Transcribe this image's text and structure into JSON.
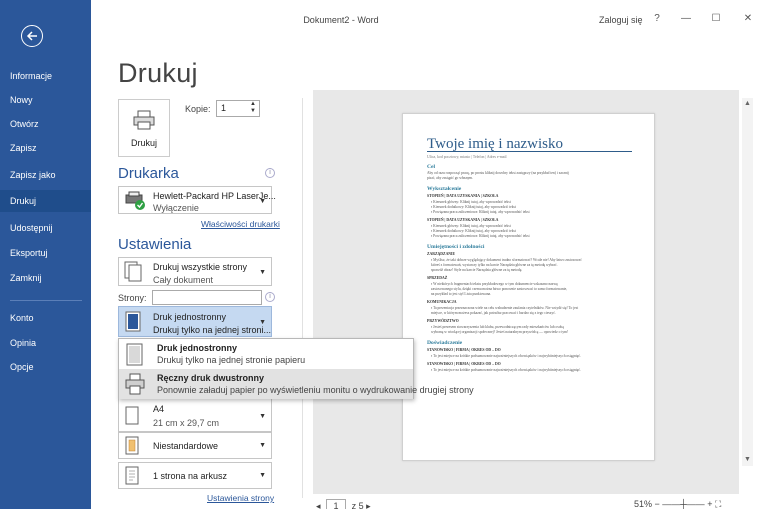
{
  "window": {
    "title": "Dokument2 - Word",
    "signin": "Zaloguj się",
    "help": "?",
    "minimize": "—",
    "maximize": "☐",
    "close": "✕"
  },
  "nav": {
    "items": [
      {
        "label": "Informacje"
      },
      {
        "label": "Nowy"
      },
      {
        "label": "Otwórz"
      },
      {
        "label": "Zapisz"
      },
      {
        "label": "Zapisz jako"
      },
      {
        "label": "Drukuj"
      },
      {
        "label": "Udostępnij"
      },
      {
        "label": "Eksportuj"
      },
      {
        "label": "Zamknij"
      },
      {
        "label": "Konto"
      },
      {
        "label": "Opinia"
      },
      {
        "label": "Opcje"
      }
    ],
    "active": "Drukuj"
  },
  "print": {
    "heading": "Drukuj",
    "button_label": "Drukuj",
    "copies_label": "Kopie:",
    "copies_value": "1"
  },
  "printer": {
    "heading": "Drukarka",
    "name": "Hewlett-Packard HP LaserJe...",
    "status": "Wyłączenie",
    "properties_link": "Właściwości drukarki"
  },
  "settings": {
    "heading": "Ustawienia",
    "range_title": "Drukuj wszystkie strony",
    "range_sub": "Cały dokument",
    "pages_label": "Strony:",
    "pages_value": "",
    "sides_title": "Druk jednostronny",
    "sides_sub": "Drukuj tylko na jednej stroni...",
    "paper_title": "A4",
    "paper_sub": "21 cm x 29,7 cm",
    "margins_title": "Niestandardowe",
    "persheet_title": "1 strona na arkusz",
    "page_setup_link": "Ustawienia strony"
  },
  "popup": {
    "options": [
      {
        "title": "Druk jednostronny",
        "sub": "Drukuj tylko na jednej stronie papieru"
      },
      {
        "title": "Ręczny druk dwustronny",
        "sub": "Ponownie załaduj papier po wyświetleniu monitu o wydrukowanie drugiej strony"
      }
    ]
  },
  "preview": {
    "name": "Twoje imię i nazwisko",
    "contact": "Ulica, kod pocztowy, miasto | Telefon | Adres e-mail",
    "s_goal": "Cel",
    "goal_1": "Aby od razu rozpocząć pracę, po prostu kliknij dowolny tekst zastępczy (na przykład ten) i zacznij",
    "goal_2": "pisać, aby zastąpić go własnym.",
    "s_edu": "Wykształcenie",
    "edu_sub": "STOPIEŃ | DATA UZYSKANIA | SZKOŁA",
    "edu_b1": "▪ Kierunek główny: Kliknij tutaj, aby wprowadzić tekst",
    "edu_b2": "▪ Kierunek dodatkowy: Kliknij tutaj, aby wprowadzić tekst",
    "edu_b3": "▪ Powiązana praca zaliczeniowa: Kliknij tutaj, aby wprowadzić tekst",
    "edu_sub2": "STOPIEŃ | DATA UZYSKANIA | SZKOŁA",
    "edu_b4": "▪ Kierunek główny: Kliknij tutaj, aby wprowadzić tekst",
    "edu_b5": "▪ Kierunek dodatkowy: Kliknij tutaj, aby wprowadzić tekst",
    "edu_b6": "▪ Powiązana praca zaliczeniowa: Kliknij tutaj, aby wprowadzić tekst",
    "s_skills": "Umiejętności i zdolności",
    "sk_sub1": "ZARZĄDZANIE",
    "sk_t1": "▪ Myślisz, że taki dobrze wyglądający dokument trudno sformatować? Wcale nie! Aby łatwo zastosować",
    "sk_t2": "   któreś z formatowań, wystarczy tylko na karcie Narzędzia główne za tę metodę wybrać.",
    "sk_t3": "   sprawdź obraz! Style na karcie Narzędzia główne za tę metodę.",
    "sk_sub2": "SPRZEDAŻ",
    "sk_t4": "▪ W niektórych fragmentach tekstu przykładowego w tym dokumencie wskazano nazwę",
    "sk_t5": "   zastosowanego stylu, dzięki czemu można łatwo ponownie zastosować to samo formatowanie,",
    "sk_t6": "   na przykład to jest styl Lista punktowana.",
    "sk_sub3": "KOMUNIKACJA",
    "sk_t7": "▪ Ta prezentacja przeznaczona wiele na celu wzbudzenie zaufania czytelników. Nie wstydź się! To jest",
    "sk_t8": "   miejsce, w którym możesz pokazać, jak potrafisz pracować i bardzo się z tego cieszyć.",
    "sk_sub4": "PRZYWÓDZTWO",
    "sk_t9": "▪ Jesteś prezesem stowarzyszenia lub klubu, przewodniczącym rady mieszkańców lub osobą",
    "sk_t10": "   wybraną w wiodącej organizacji społecznej? Jesteś naturalnym przywódcą — opowiedz o tym!",
    "s_exp": "Doświadczenie",
    "exp_sub1": "STANOWISKO | FIRMA | OKRES OD – DO",
    "exp_t1": "▪ To jest miejsce na krótkie podsumowanie najważniejszych obowiązków i najwybitniejszych osiągnięć.",
    "exp_sub2": "STANOWISKO | FIRMA | OKRES OD – DO",
    "exp_t2": "▪ To jest miejsce na krótkie podsumowanie najważniejszych obowiązków i najwybitniejszych osiągnięć."
  },
  "pager": {
    "current": "1",
    "of": "z 5"
  },
  "zoom": {
    "level": "51%"
  },
  "colors": {
    "nav_bg": "#2b579a",
    "accent": "#2b579a",
    "selected_bg": "#c5d9f1"
  }
}
